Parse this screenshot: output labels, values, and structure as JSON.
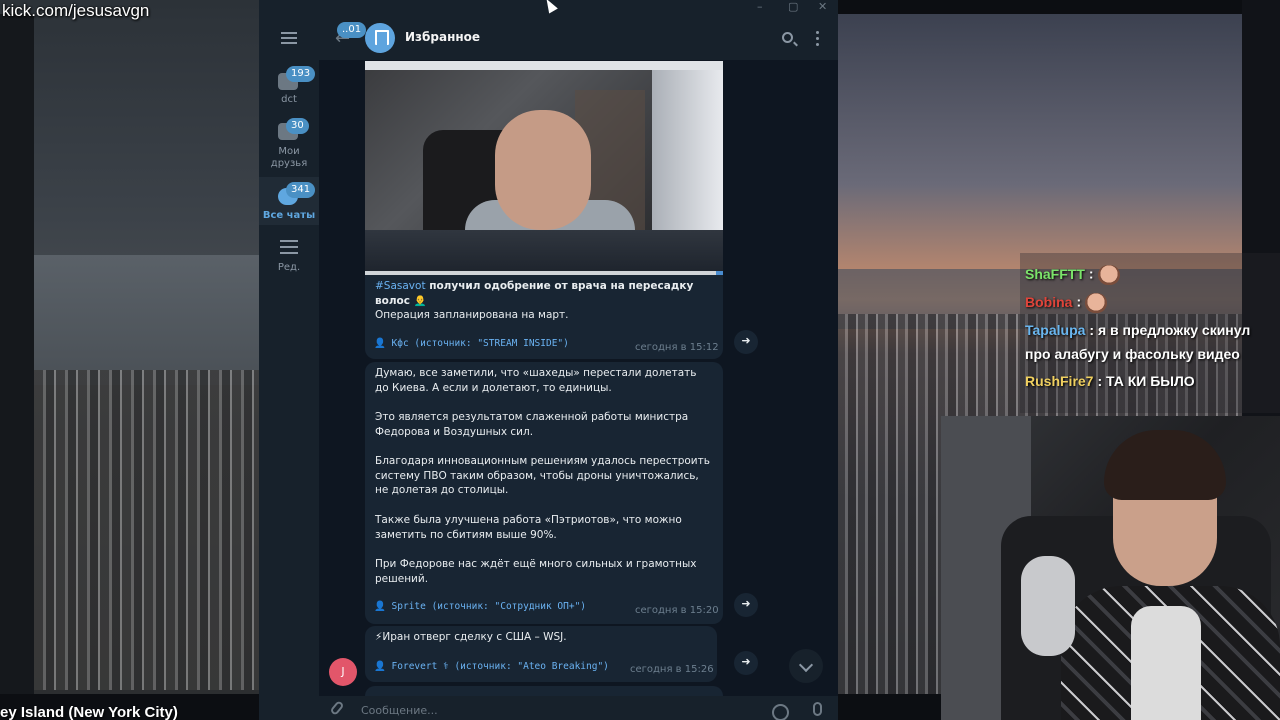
{
  "stream": {
    "channel_url": "kick.com/jesusavgn",
    "location_caption": "ey Island (New York City)"
  },
  "chat_overlay": [
    {
      "user": "ShaFFTT",
      "sep": ":",
      "text": "",
      "color": "#7be36a",
      "emote": true
    },
    {
      "user": "Bobina",
      "sep": ":",
      "text": "",
      "color": "#e0443a",
      "emote": true
    },
    {
      "user": "Tapalupa",
      "sep": ":",
      "text": "я в предложку скинул",
      "color": "#6ab7f0",
      "emote": false
    },
    {
      "user": "",
      "sep": "",
      "text": "про алабугу и фасольку видео",
      "color": "#ffffff",
      "emote": false
    },
    {
      "user": "RushFire7",
      "sep": ":",
      "text": "ТА КИ БЫЛО",
      "color": "#f0d060",
      "emote": false
    }
  ],
  "telegram": {
    "window_controls": [
      "–",
      "▢",
      "✕"
    ],
    "folders": [
      {
        "label": "dct",
        "badge": "193",
        "icon": "folder-icon",
        "active": false
      },
      {
        "label": "Мои друзья",
        "label_line1": "Мои",
        "label_line2": "друзья",
        "badge": "30",
        "icon": "folder-icon",
        "active": false
      },
      {
        "label": "Все чаты",
        "badge": "341",
        "icon": "chats-icon",
        "active": true
      },
      {
        "label": "Ред.",
        "icon": "sliders-icon",
        "active": false
      }
    ],
    "header": {
      "back_badge": "..01",
      "title": "Избранное"
    },
    "media": {
      "progress": 0.98
    },
    "messages": [
      {
        "hashtag": "#Sasavot",
        "title_rest": " получил одобрение от врача на пересадку волос 👨‍🦲",
        "body": "Операция запланирована на март.",
        "source": "👤 Кфс (источник: \"STREAM INSIDE\")",
        "time": "сегодня в 15:12"
      },
      {
        "paragraphs": [
          "Думаю, все заметили, что «шахеды» перестали долетать до Киева. А если и долетают, то единицы.",
          "Это является результатом слаженной работы министра Федорова и Воздушных сил.",
          "Благодаря инновационным решениям удалось перестроить систему ПВО таким образом, чтобы дроны уничтожались, не долетая до столицы.",
          "Также была улучшена работа «Пэтриотов», что можно заметить по сбитиям выше 90%.",
          "При Федорове нас ждёт ещё много сильных и грамотных решений."
        ],
        "source": "👤 Sprite (источник: \"Сотрудник ОП+\")",
        "time": "сегодня в 15:20"
      },
      {
        "body": "⚡Иран отверг сделку с США – WSJ.",
        "source": "👤 Forevert ⚕ (источник: \"Ateo Breaking\")",
        "time": "сегодня в 15:26",
        "author_initial": "J"
      }
    ],
    "input": {
      "placeholder": "Сообщение..."
    }
  }
}
